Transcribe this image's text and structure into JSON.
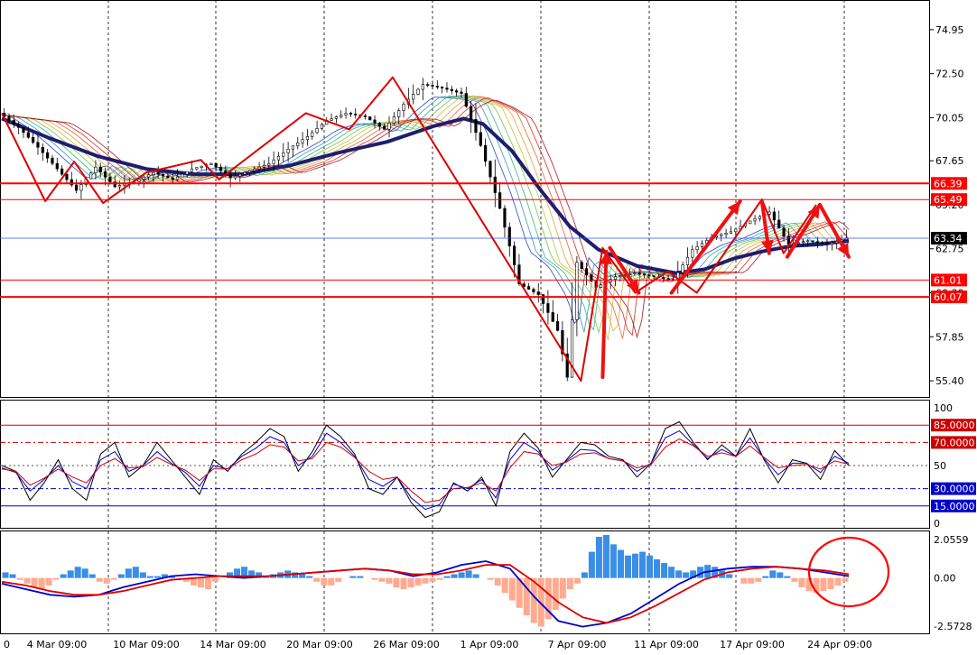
{
  "chart_data": [
    {
      "type": "candlestick",
      "panel": "price",
      "title": "",
      "x_tick_labels": [
        "0",
        "4 Mar 09:00",
        "10 Mar 09:00",
        "14 Mar 09:00",
        "20 Mar 09:00",
        "26 Mar 09:00",
        "1 Apr 09:00",
        "7 Apr 09:00",
        "11 Apr 09:00",
        "17 Apr 09:00",
        "24 Apr 09:00"
      ],
      "y_tick_labels": [
        "74.95",
        "72.50",
        "70.05",
        "67.65",
        "65.20",
        "62.75",
        "60.30",
        "57.85",
        "55.40"
      ],
      "ylim": [
        54.6,
        76.4
      ],
      "close_path": [
        [
          0,
          70.3
        ],
        [
          4,
          69.5
        ],
        [
          8,
          68.4
        ],
        [
          12,
          67.2
        ],
        [
          16,
          66.0
        ],
        [
          20,
          67.3
        ],
        [
          24,
          66.2
        ],
        [
          28,
          66.5
        ],
        [
          32,
          67.0
        ],
        [
          36,
          66.6
        ],
        [
          40,
          67.2
        ],
        [
          44,
          67.5
        ],
        [
          48,
          66.7
        ],
        [
          52,
          67.1
        ],
        [
          56,
          67.5
        ],
        [
          60,
          68.3
        ],
        [
          64,
          69.0
        ],
        [
          68,
          69.9
        ],
        [
          72,
          70.3
        ],
        [
          76,
          70.1
        ],
        [
          80,
          69.4
        ],
        [
          84,
          70.8
        ],
        [
          88,
          71.9
        ],
        [
          92,
          71.7
        ],
        [
          96,
          71.4
        ],
        [
          100,
          68.5
        ],
        [
          104,
          65.0
        ],
        [
          108,
          60.8
        ],
        [
          112,
          60.2
        ],
        [
          116,
          58.2
        ],
        [
          118,
          55.6
        ],
        [
          120,
          62.0
        ],
        [
          124,
          60.6
        ],
        [
          128,
          61.2
        ],
        [
          132,
          61.4
        ],
        [
          136,
          61.2
        ],
        [
          140,
          61.0
        ],
        [
          144,
          62.7
        ],
        [
          148,
          63.4
        ],
        [
          152,
          63.7
        ],
        [
          156,
          64.3
        ],
        [
          160,
          64.8
        ],
        [
          164,
          63.0
        ],
        [
          168,
          63.2
        ],
        [
          172,
          63.0
        ],
        [
          176,
          63.34
        ]
      ],
      "horizontal_levels": [
        {
          "label": "66.39",
          "value": 66.39,
          "color": "#ff0000"
        },
        {
          "label": "65.49",
          "value": 65.49,
          "color": "#ff0000"
        },
        {
          "label": "63.34",
          "value": 63.34,
          "color": "#000000"
        },
        {
          "label": "61.01",
          "value": 61.01,
          "color": "#ff0000"
        },
        {
          "label": "60.07",
          "value": 60.07,
          "color": "#ff0000"
        }
      ],
      "ma_ribbon": {
        "slow_ma_color": "#1e1e6e",
        "slow_ma": [
          [
            0,
            70.0
          ],
          [
            10,
            68.9
          ],
          [
            20,
            67.9
          ],
          [
            30,
            67.2
          ],
          [
            40,
            66.9
          ],
          [
            50,
            66.9
          ],
          [
            60,
            67.4
          ],
          [
            70,
            68.1
          ],
          [
            80,
            68.7
          ],
          [
            90,
            69.6
          ],
          [
            96,
            70.0
          ],
          [
            100,
            69.7
          ],
          [
            106,
            68.2
          ],
          [
            112,
            66.0
          ],
          [
            118,
            64.0
          ],
          [
            124,
            62.7
          ],
          [
            132,
            61.8
          ],
          [
            140,
            61.4
          ],
          [
            146,
            61.6
          ],
          [
            152,
            62.2
          ],
          [
            158,
            62.6
          ],
          [
            164,
            62.9
          ],
          [
            170,
            63.0
          ],
          [
            176,
            63.2
          ]
        ]
      },
      "zigzag": [
        [
          0,
          70.3
        ],
        [
          12,
          65.4
        ],
        [
          20,
          67.6
        ],
        [
          28,
          65.3
        ],
        [
          40,
          67.0
        ],
        [
          55,
          67.7
        ],
        [
          60,
          66.6
        ],
        [
          84,
          70.3
        ],
        [
          96,
          69.4
        ],
        [
          108,
          72.3
        ],
        [
          160,
          55.4
        ],
        [
          166,
          62.8
        ],
        [
          175,
          60.3
        ],
        [
          184,
          61.5
        ],
        [
          192,
          60.3
        ],
        [
          210,
          65.5
        ],
        [
          216,
          62.5
        ],
        [
          225,
          65.2
        ]
      ],
      "projection_arrows": [
        [
          [
            166,
            55.6
          ],
          [
            167,
            62.6
          ]
        ],
        [
          [
            168,
            62.8
          ],
          [
            176,
            60.3
          ]
        ],
        [
          [
            185,
            60.3
          ],
          [
            204,
            65.4
          ]
        ],
        [
          [
            210,
            65.4
          ],
          [
            212,
            62.5
          ]
        ],
        [
          [
            217,
            62.3
          ],
          [
            226,
            65.2
          ]
        ],
        [
          [
            226,
            65.2
          ],
          [
            234,
            62.3
          ]
        ]
      ]
    },
    {
      "type": "line",
      "panel": "stochastic",
      "y_tick_labels": [
        "100",
        "85.0000",
        "70.0000",
        "50",
        "30.0000",
        "15.0000",
        "0"
      ],
      "ylim": [
        0,
        100
      ],
      "levels": [
        {
          "label": "85.0000",
          "value": 85,
          "color": "#cc0000"
        },
        {
          "label": "70.0000",
          "value": 70,
          "color": "#cc0000"
        },
        {
          "label": "30.0000",
          "value": 30,
          "color": "#0000cc"
        },
        {
          "label": "15.0000",
          "value": 15,
          "color": "#0000cc"
        }
      ],
      "series": [
        {
          "color": "#000000",
          "values": [
            50,
            45,
            20,
            35,
            55,
            30,
            20,
            60,
            70,
            40,
            50,
            70,
            55,
            40,
            25,
            55,
            45,
            60,
            70,
            82,
            75,
            45,
            62,
            85,
            75,
            60,
            30,
            25,
            40,
            18,
            5,
            10,
            35,
            28,
            40,
            15,
            62,
            78,
            65,
            40,
            55,
            70,
            68,
            58,
            55,
            40,
            52,
            82,
            88,
            70,
            55,
            68,
            58,
            82,
            55,
            35,
            55,
            52,
            38,
            63,
            50
          ]
        },
        {
          "color": "#0000cc",
          "values": [
            48,
            44,
            28,
            38,
            50,
            36,
            30,
            55,
            62,
            45,
            50,
            62,
            52,
            44,
            32,
            50,
            47,
            58,
            65,
            75,
            70,
            50,
            58,
            78,
            70,
            58,
            38,
            32,
            40,
            22,
            12,
            16,
            34,
            30,
            38,
            22,
            55,
            70,
            62,
            46,
            54,
            64,
            63,
            56,
            54,
            45,
            52,
            74,
            80,
            68,
            56,
            64,
            58,
            74,
            56,
            42,
            52,
            52,
            44,
            58,
            52
          ]
        },
        {
          "color": "#cc0000",
          "values": [
            47,
            45,
            33,
            39,
            47,
            40,
            35,
            50,
            56,
            48,
            49,
            57,
            51,
            46,
            37,
            47,
            47,
            55,
            60,
            68,
            66,
            54,
            56,
            70,
            66,
            57,
            45,
            38,
            40,
            28,
            18,
            20,
            30,
            31,
            35,
            28,
            48,
            62,
            60,
            50,
            53,
            60,
            61,
            56,
            54,
            48,
            51,
            66,
            73,
            67,
            58,
            61,
            58,
            67,
            57,
            48,
            50,
            51,
            47,
            54,
            51
          ]
        }
      ]
    },
    {
      "type": "bar",
      "panel": "macd",
      "y_tick_labels": [
        "2.0559",
        "0.00",
        "-2.5728"
      ],
      "ylim": [
        -2.5728,
        2.0559
      ],
      "colors": {
        "positive": "#3a8ee6",
        "negative": "#ffab8f",
        "main": "#0000cc",
        "signal": "#dd0000"
      },
      "histogram": [
        0.3,
        0.2,
        -0.1,
        -0.3,
        -0.5,
        -0.6,
        -0.4,
        -0.1,
        0.2,
        0.4,
        0.6,
        0.5,
        0.2,
        -0.2,
        -0.3,
        -0.1,
        0.2,
        0.5,
        0.6,
        0.3,
        0.1,
        0.1,
        0.2,
        0.1,
        -0.1,
        -0.2,
        -0.4,
        -0.5,
        -0.6,
        -0.2,
        0.0,
        0.3,
        0.5,
        0.6,
        0.4,
        0.3,
        0.1,
        0.2,
        0.3,
        0.4,
        0.3,
        0.2,
        0.1,
        -0.2,
        -0.4,
        -0.4,
        -0.2,
        0.0,
        0.1,
        0.1,
        0.0,
        -0.1,
        -0.2,
        -0.3,
        -0.5,
        -0.6,
        -0.5,
        -0.4,
        -0.3,
        -0.2,
        -0.1,
        0.1,
        0.2,
        0.3,
        0.4,
        0.2,
        0.0,
        -0.1,
        -0.4,
        -0.8,
        -1.2,
        -1.6,
        -2.0,
        -2.4,
        -2.6,
        -2.2,
        -1.7,
        -1.1,
        -0.6,
        -0.3,
        0.3,
        1.4,
        2.2,
        2.3,
        1.8,
        1.5,
        1.2,
        1.3,
        1.4,
        1.2,
        1.0,
        0.8,
        0.6,
        0.4,
        0.3,
        0.4,
        0.6,
        0.7,
        0.6,
        0.4,
        0.2,
        0.0,
        -0.3,
        -0.3,
        -0.2,
        0.1,
        0.4,
        0.3,
        0.1,
        -0.2,
        -0.5,
        -0.7,
        -0.8,
        -0.7,
        -0.6,
        -0.4,
        -0.2
      ],
      "main_line": [
        -0.3,
        -0.6,
        -0.9,
        -1.0,
        -0.9,
        -0.5,
        -0.2,
        0.1,
        0.2,
        0.1,
        0.0,
        0.1,
        0.2,
        0.3,
        0.4,
        0.5,
        0.4,
        0.1,
        0.3,
        0.7,
        0.9,
        0.5,
        -1.0,
        -2.3,
        -2.6,
        -2.4,
        -1.9,
        -1.1,
        -0.3,
        0.3,
        0.5,
        0.6,
        0.6,
        0.5,
        0.3,
        0.1
      ],
      "signal_line": [
        -0.2,
        -0.4,
        -0.7,
        -0.9,
        -0.9,
        -0.7,
        -0.4,
        -0.1,
        0.0,
        0.1,
        0.1,
        0.1,
        0.2,
        0.3,
        0.4,
        0.5,
        0.4,
        0.2,
        0.2,
        0.4,
        0.7,
        0.7,
        -0.2,
        -1.3,
        -2.1,
        -2.4,
        -2.1,
        -1.5,
        -0.8,
        -0.1,
        0.3,
        0.5,
        0.6,
        0.5,
        0.4,
        0.2
      ]
    }
  ]
}
